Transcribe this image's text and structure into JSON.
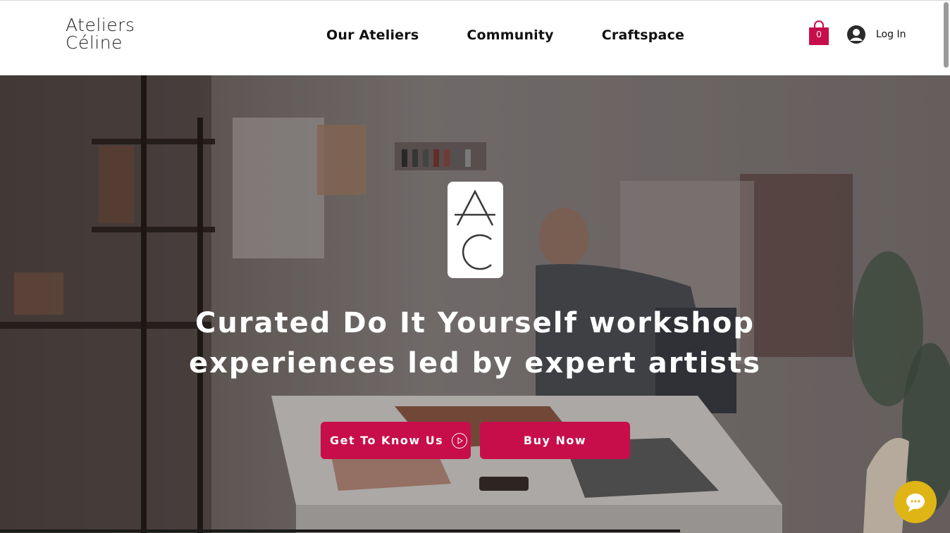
{
  "header": {
    "brand_line1": "Ateliers",
    "brand_line2": "Céline",
    "nav": [
      "Our Ateliers",
      "Community",
      "Craftspace"
    ],
    "cart_count": "0",
    "login_label": "Log In"
  },
  "hero": {
    "logo_letters": [
      "A",
      "C"
    ],
    "headline_line1": "Curated Do It Yourself workshop",
    "headline_line2": "experiences led by expert artists",
    "cta_primary": "Get To Know Us",
    "cta_secondary": "Buy Now"
  },
  "colors": {
    "accent": "#c70e4a",
    "chat": "#dfb516",
    "overlay": "#5e5655"
  },
  "icons": [
    "shopping-bag-icon",
    "user-avatar-icon",
    "play-circle-icon",
    "chat-bubble-icon"
  ]
}
